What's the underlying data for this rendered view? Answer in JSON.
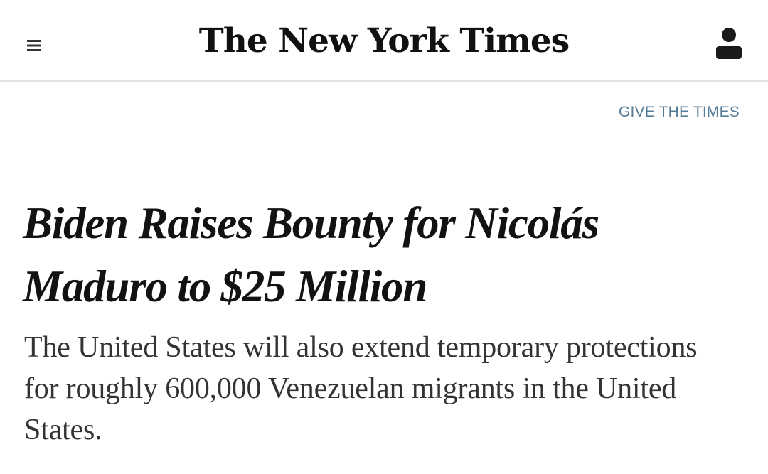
{
  "header": {
    "masthead": "The New York Times",
    "menu_icon": "hamburger-menu-icon",
    "account_icon": "user-account-icon"
  },
  "promo": {
    "give_link": "GIVE THE TIMES"
  },
  "article": {
    "headline": "Biden Raises Bounty for Nicolás Maduro to $25 Million",
    "summary": "The United States will also extend temporary protections for roughly 600,000 Venezuelan migrants in the United States."
  },
  "colors": {
    "link": "#567b95",
    "text": "#121212",
    "summary_text": "#333333",
    "divider": "#e2e2e2"
  }
}
